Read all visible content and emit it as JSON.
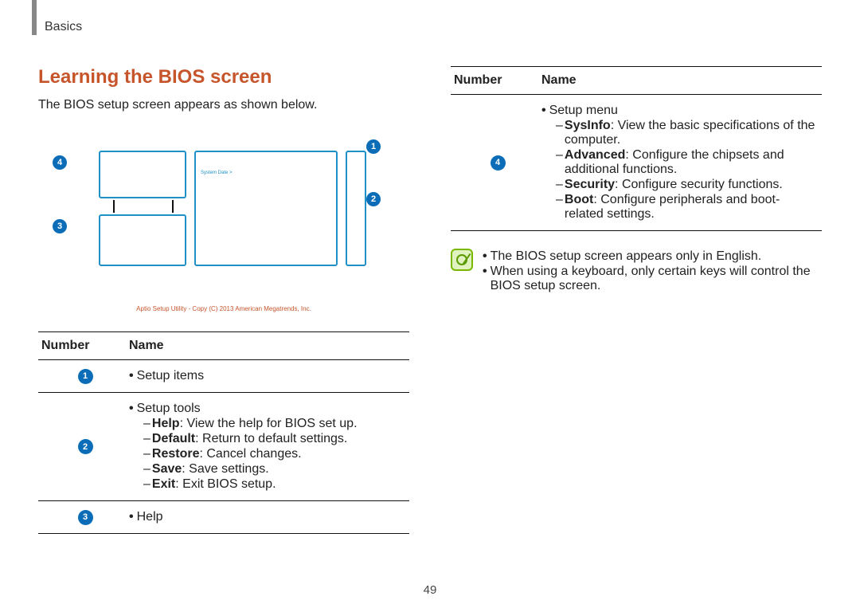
{
  "breadcrumb": "Basics",
  "title": "Learning the BIOS screen",
  "intro": "The BIOS setup screen appears as shown below.",
  "diagram": {
    "sample_text": "System Date >",
    "footer": "Aptio Setup Utility - Copy (C) 2013 American Megatrends, Inc."
  },
  "legend_header": {
    "number": "Number",
    "name": "Name"
  },
  "rows": [
    {
      "num": "1",
      "title": "Setup items",
      "subs": []
    },
    {
      "num": "2",
      "title": "Setup tools",
      "subs": [
        {
          "b": "Help",
          "t": ": View the help for BIOS set up."
        },
        {
          "b": "Default",
          "t": ": Return to default settings."
        },
        {
          "b": "Restore",
          "t": ": Cancel changes."
        },
        {
          "b": "Save",
          "t": ": Save settings."
        },
        {
          "b": "Exit",
          "t": ": Exit BIOS setup."
        }
      ]
    },
    {
      "num": "3",
      "title": "Help",
      "subs": []
    }
  ],
  "rows2": [
    {
      "num": "4",
      "title": "Setup menu",
      "subs": [
        {
          "b": "SysInfo",
          "t": ": View the basic specifications of the computer."
        },
        {
          "b": "Advanced",
          "t": ": Configure the chipsets and additional functions."
        },
        {
          "b": "Security",
          "t": ": Configure security functions."
        },
        {
          "b": "Boot",
          "t": ": Configure peripherals and boot-related settings."
        }
      ]
    }
  ],
  "notes": [
    "The BIOS setup screen appears only in English.",
    "When using a keyboard, only certain keys will control the BIOS setup screen."
  ],
  "page": "49"
}
